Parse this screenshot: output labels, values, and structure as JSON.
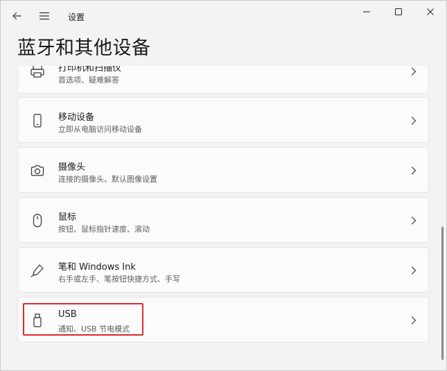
{
  "window": {
    "app_title": "设置",
    "page_title": "蓝牙和其他设备"
  },
  "controls": {
    "back_icon": "arrow-left-icon",
    "menu_icon": "hamburger-icon",
    "minimize_icon": "minimize-icon",
    "maximize_icon": "maximize-icon",
    "close_icon": "close-icon"
  },
  "items": [
    {
      "id": "printers",
      "title": "打印机和扫描仪",
      "subtitle": "首选项、疑难解答",
      "icon": "printer-icon"
    },
    {
      "id": "mobile",
      "title": "移动设备",
      "subtitle": "立即从电脑访问移动设备",
      "icon": "phone-icon"
    },
    {
      "id": "camera",
      "title": "摄像头",
      "subtitle": "连接的摄像头、默认图像设置",
      "icon": "camera-icon"
    },
    {
      "id": "mouse",
      "title": "鼠标",
      "subtitle": "按钮、鼠标指针速度、滚动",
      "icon": "mouse-icon"
    },
    {
      "id": "pen",
      "title": "笔和 Windows Ink",
      "subtitle": "右手或左手、笔按钮快捷方式、手写",
      "icon": "pen-icon"
    },
    {
      "id": "usb",
      "title": "USB",
      "subtitle": "通知、USB 节电模式",
      "icon": "usb-icon"
    }
  ],
  "colors": {
    "background": "#f3f3f3",
    "card": "#fbfbfb",
    "highlight": "#e0282e"
  }
}
